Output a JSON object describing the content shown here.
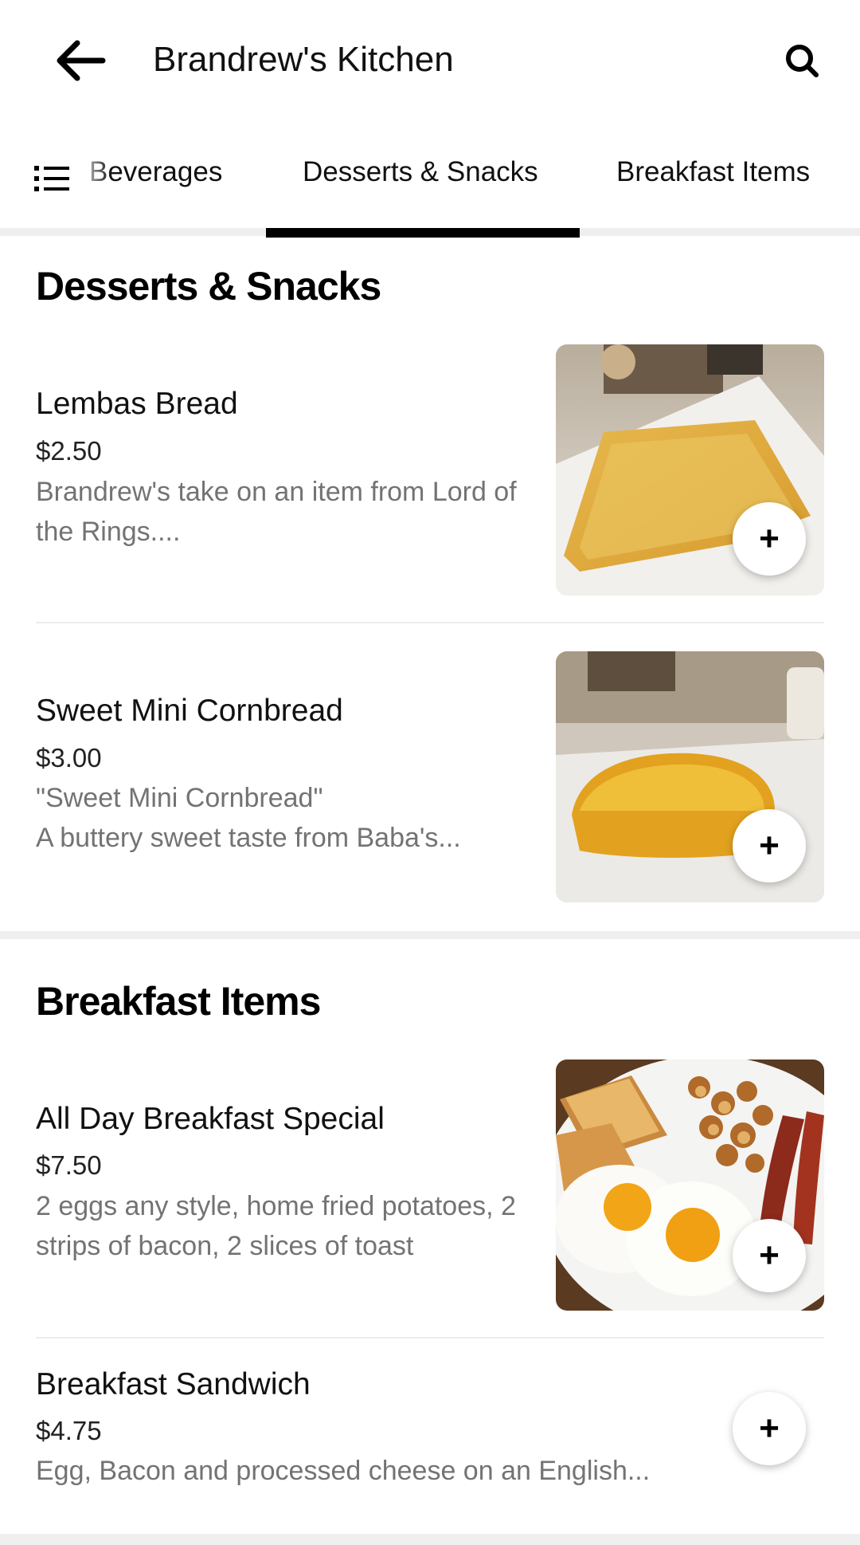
{
  "header": {
    "title": "Brandrew's Kitchen",
    "back_icon": "arrow-left-icon",
    "search_icon": "search-icon"
  },
  "tabs": {
    "menu_icon": "list-icon",
    "items": [
      {
        "label": "Beverages",
        "active": false
      },
      {
        "label": "Desserts & Snacks",
        "active": true
      },
      {
        "label": "Breakfast Items",
        "active": false
      }
    ]
  },
  "sections": [
    {
      "title": "Desserts & Snacks",
      "items": [
        {
          "name": "Lembas Bread",
          "price": "$2.50",
          "description": "Brandrew's take on an item from Lord of the Rings....",
          "has_image": true,
          "image": "toast-photo"
        },
        {
          "name": "Sweet Mini Cornbread",
          "price": "$3.00",
          "description": "\"Sweet Mini Cornbread\"\nA buttery sweet taste from Baba's...",
          "has_image": true,
          "image": "cornbread-photo"
        }
      ]
    },
    {
      "title": "Breakfast Items",
      "items": [
        {
          "name": "All Day Breakfast Special",
          "price": "$7.50",
          "description": "2 eggs any style, home fried potatoes, 2 strips of bacon, 2 slices of toast",
          "has_image": true,
          "image": "breakfast-plate-photo"
        },
        {
          "name": "Breakfast Sandwich",
          "price": "$4.75",
          "description": "Egg, Bacon and processed cheese on an English...",
          "has_image": false
        }
      ]
    }
  ],
  "add_label": "+",
  "colors": {
    "accent": "#000000",
    "muted_text": "#737373",
    "divider": "#efefef"
  }
}
